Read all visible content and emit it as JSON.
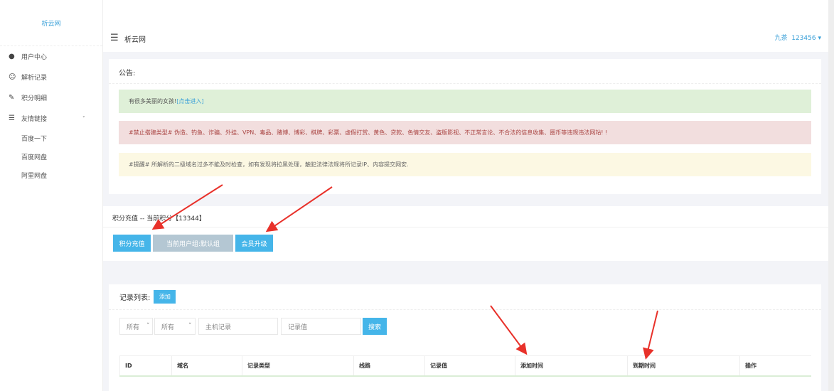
{
  "sidebar": {
    "logo": "析云网",
    "items": [
      {
        "label": "用户中心",
        "icon": "user-icon"
      },
      {
        "label": "解析记录",
        "icon": "record-icon"
      },
      {
        "label": "积分明细",
        "icon": "pencil-icon"
      },
      {
        "label": "友情链接",
        "icon": "menu-icon"
      }
    ],
    "sub_items": [
      "百度一下",
      "百度网盘",
      "阿里网盘"
    ]
  },
  "header": {
    "title": "析云网",
    "user_name": "九茶",
    "user_id": "123456"
  },
  "notice": {
    "title": "公告:",
    "alerts": [
      {
        "text": "有很多美丽的女孩! ",
        "link": "[点击进入]"
      },
      {
        "text": "#禁止搭建类型# 伪造、钓鱼、诈骗、外挂、VPN、毒品、赌博、博彩、棋牌、彩票、虚假打赏、黄色、贷款、色情交友、盗版影视、不正常言论、不合法的信息收集、圈币等违规违法网站! !"
      },
      {
        "text": "#提醒# 所解析的二级域名过多不能及时检查，如有发现将拉黑处理，触犯法律法规将所记录IP、内容提交网安."
      }
    ]
  },
  "points": {
    "title": "积分充值 -- 当前积分【13344】",
    "recharge": "积分充值",
    "group": "当前用户组:默认组",
    "upgrade": "会员升级"
  },
  "records": {
    "title": "记录列表:",
    "add": "添加",
    "filter1": "所有",
    "filter2": "所有",
    "host_placeholder": "主机记录",
    "value_placeholder": "记录值",
    "search": "搜索",
    "columns": [
      "ID",
      "域名",
      "记录类型",
      "线路",
      "记录值",
      "添加时间",
      "到期时间",
      "操作"
    ]
  },
  "colors": {
    "accent": "#45b5e9",
    "arrow": "#e8312a"
  }
}
